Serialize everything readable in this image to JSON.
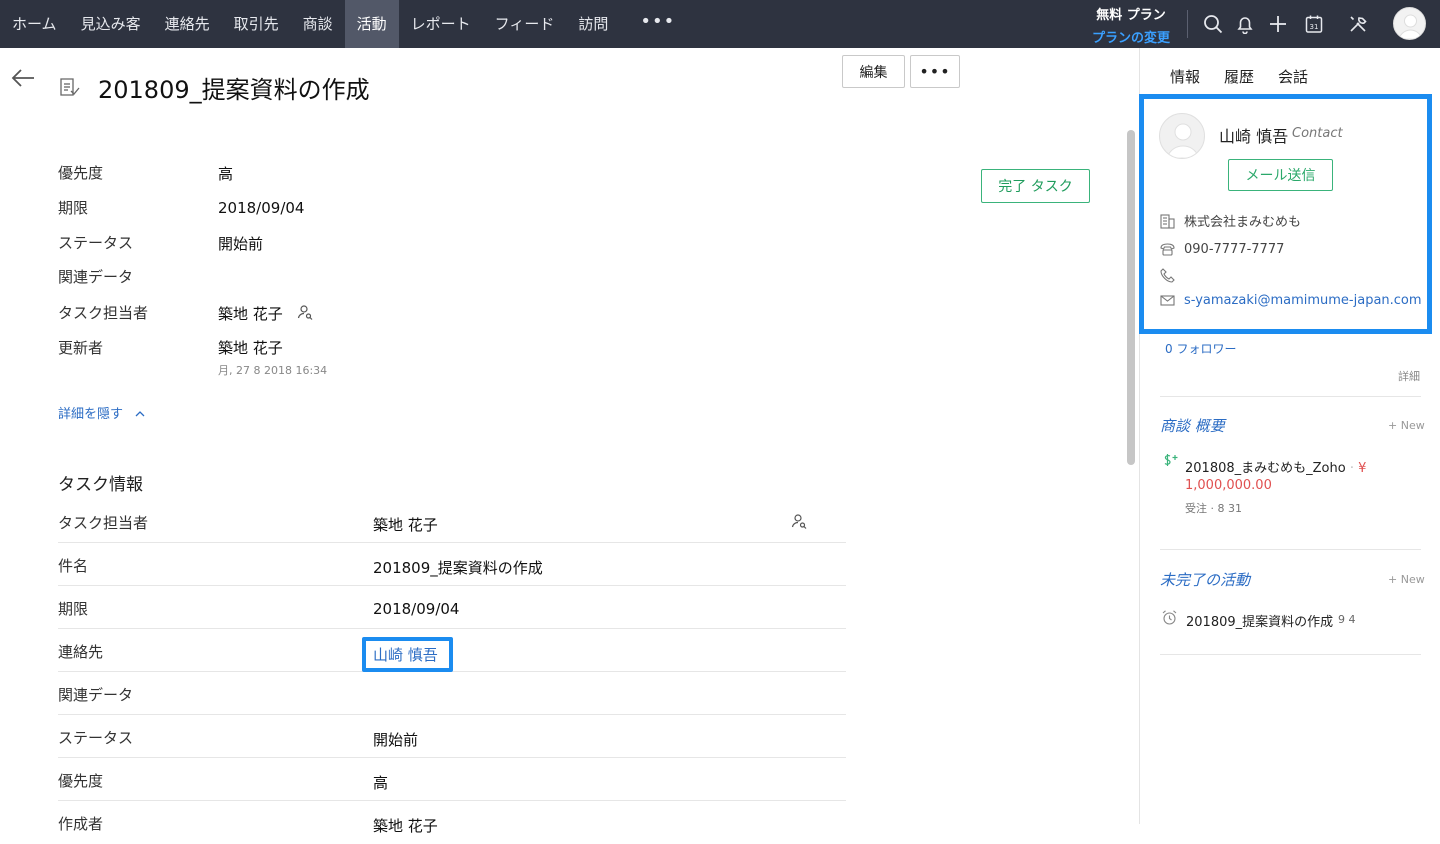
{
  "nav": {
    "items": [
      {
        "label": "ホーム",
        "active": false
      },
      {
        "label": "見込み客",
        "active": false
      },
      {
        "label": "連絡先",
        "active": false
      },
      {
        "label": "取引先",
        "active": false
      },
      {
        "label": "商談",
        "active": false
      },
      {
        "label": "活動",
        "active": true
      },
      {
        "label": "レポート",
        "active": false
      },
      {
        "label": "フィード",
        "active": false
      },
      {
        "label": "訪問",
        "active": false
      }
    ],
    "more": "•••",
    "plan_label": "無料 プラン",
    "plan_change": "プランの変更",
    "icons": [
      "search-icon",
      "bell-icon",
      "plus-icon",
      "calendar-icon",
      "tools-icon",
      "user-avatar"
    ],
    "calendar_day": "31"
  },
  "header": {
    "title": "201809_提案資料の作成",
    "edit_button": "編集",
    "more_button": "•••",
    "complete_button": "完了 タスク"
  },
  "summary": {
    "fields": [
      {
        "label": "優先度",
        "value": "高"
      },
      {
        "label": "期限",
        "value": "2018/09/04"
      },
      {
        "label": "ステータス",
        "value": "開始前"
      },
      {
        "label": "関連データ",
        "value": ""
      },
      {
        "label": "タスク担当者",
        "value": "築地 花子"
      },
      {
        "label": "更新者",
        "value": "築地 花子"
      }
    ],
    "modified_time": "月, 27 8 2018 16:34",
    "hide_details": "詳細を隠す"
  },
  "task_info": {
    "title": "タスク情報",
    "rows": [
      {
        "label": "タスク担当者",
        "value": "築地 花子"
      },
      {
        "label": "件名",
        "value": "201809_提案資料の作成"
      },
      {
        "label": "期限",
        "value": "2018/09/04"
      },
      {
        "label": "連絡先",
        "value": "山崎 慎吾"
      },
      {
        "label": "関連データ",
        "value": ""
      },
      {
        "label": "ステータス",
        "value": "開始前"
      },
      {
        "label": "優先度",
        "value": "高"
      },
      {
        "label": "作成者",
        "value": "築地 花子"
      }
    ]
  },
  "right_panel": {
    "tabs": [
      "情報",
      "履歴",
      "会話"
    ],
    "contact": {
      "name": "山崎 慎吾",
      "type": "Contact",
      "mail_button": "メール送信",
      "company": "株式会社まみむめも",
      "phone": "090-7777-7777",
      "mobile": "",
      "email": "s-yamazaki@mamimume-japan.com"
    },
    "followers": "0 フォロワー",
    "details": "詳細",
    "deals": {
      "title": "商談 概要",
      "new_label": "+ New",
      "item_name": "201808_まみむめも_Zoho",
      "currency": "¥",
      "amount": "1,000,000.00",
      "stage": "受注",
      "date": "8 31"
    },
    "open_activities": {
      "title": "未完了の活動",
      "new_label": "+ New",
      "item_name": "201809_提案資料の作成",
      "date": "9 4"
    }
  }
}
